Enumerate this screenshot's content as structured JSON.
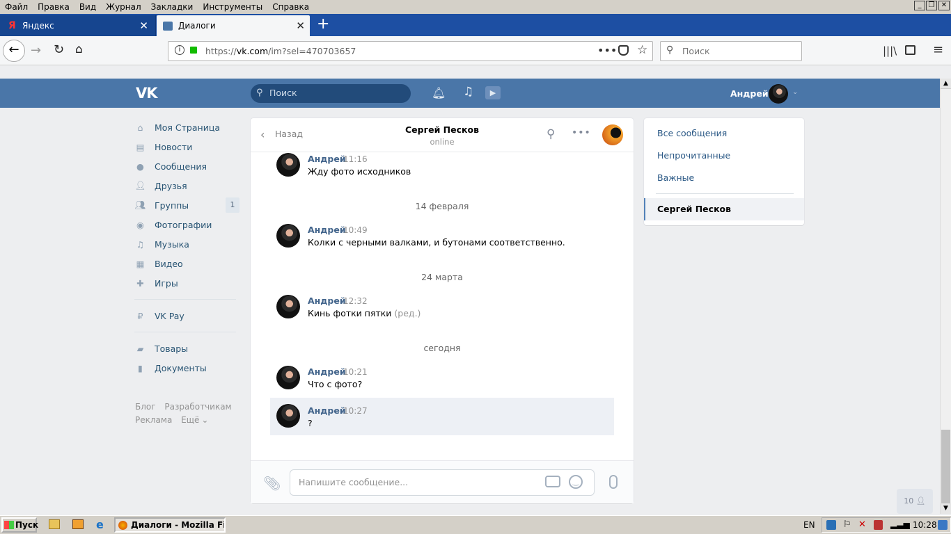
{
  "menubar": {
    "items": [
      "Файл",
      "Правка",
      "Вид",
      "Журнал",
      "Закладки",
      "Инструменты",
      "Справка"
    ]
  },
  "tabs": [
    {
      "label": "Яндекс",
      "icon": "yandex-icon"
    },
    {
      "label": "Диалоги",
      "icon": "chat-icon"
    }
  ],
  "browser": {
    "url": "https://vk.com/im?sel=470703657",
    "url_domain": "vk.com",
    "url_prefix": "https://",
    "url_suffix": "/im?sel=470703657",
    "search_placeholder": "Поиск"
  },
  "vk_header": {
    "search_placeholder": "Поиск",
    "user_name": "Андрей"
  },
  "leftnav": {
    "items": [
      {
        "label": "Моя Страница",
        "icon": "home-icon"
      },
      {
        "label": "Новости",
        "icon": "news-icon"
      },
      {
        "label": "Сообщения",
        "icon": "messages-icon"
      },
      {
        "label": "Друзья",
        "icon": "friends-icon"
      },
      {
        "label": "Группы",
        "icon": "groups-icon",
        "badge": "1"
      },
      {
        "label": "Фотографии",
        "icon": "camera-icon"
      },
      {
        "label": "Музыка",
        "icon": "music-icon"
      },
      {
        "label": "Видео",
        "icon": "video-icon"
      },
      {
        "label": "Игры",
        "icon": "gamepad-icon"
      },
      {
        "label": "VK Pay",
        "icon": "vkpay-icon"
      },
      {
        "label": "Товары",
        "icon": "bag-icon"
      },
      {
        "label": "Документы",
        "icon": "document-icon"
      }
    ],
    "footer": {
      "blog": "Блог",
      "dev": "Разработчикам",
      "ads": "Реклама",
      "more": "Ещё"
    }
  },
  "chat": {
    "back_label": "Назад",
    "contact_name": "Сергей Песков",
    "contact_status": "online",
    "messages": [
      {
        "author": "Андрей",
        "time": "11:16",
        "text": "Жду фото исходников",
        "edited": ""
      },
      {
        "author": "Андрей",
        "time": "10:49",
        "text": "Колки с черными валками, и бутонами соответственно.",
        "edited": ""
      },
      {
        "author": "Андрей",
        "time": "12:32",
        "text": "Кинь фотки пятки",
        "edited": "(ред.)"
      },
      {
        "author": "Андрей",
        "time": "10:21",
        "text": "Что с фото?",
        "edited": ""
      },
      {
        "author": "Андрей",
        "time": "10:27",
        "text": "?",
        "edited": ""
      }
    ],
    "dates": [
      "14 февраля",
      "24 марта",
      "сегодня"
    ],
    "composer_placeholder": "Напишите сообщение..."
  },
  "right_menu": {
    "all": "Все сообщения",
    "unread": "Непрочитанные",
    "important": "Важные",
    "active_contact": "Сергей Песков"
  },
  "online_widget": {
    "count": "10"
  },
  "taskbar": {
    "start": "Пуск",
    "window_title": "Диалоги - Mozilla Fire...",
    "lang": "EN",
    "clock": "10:28"
  },
  "colors": {
    "vk_blue": "#4a76a8",
    "link": "#2a5885",
    "author": "#42648b"
  }
}
